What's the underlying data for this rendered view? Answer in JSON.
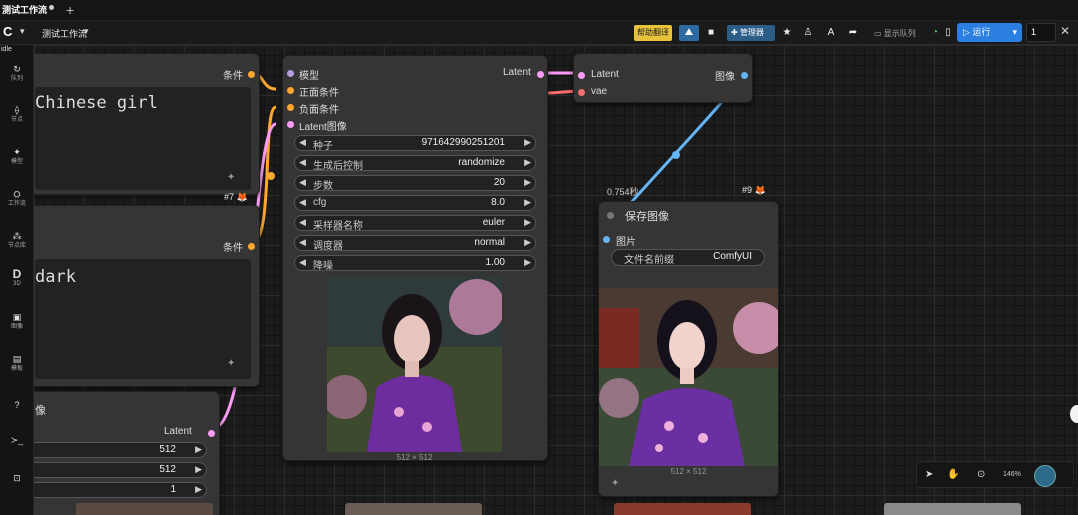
{
  "tab": {
    "title": "测试工作流",
    "add": "+"
  },
  "toolbar": {
    "logo": "C",
    "workflow_name": "测试工作流",
    "yellow_button": "帮助翻译",
    "manager_button": "管理器",
    "queue_label": "显示队列",
    "run_button": "运行",
    "run_count": "1",
    "close": "✕"
  },
  "status_label": "idle",
  "leftbar": {
    "items": [
      {
        "icon": "↻",
        "label": "队列"
      },
      {
        "icon": "⟠",
        "label": "节点"
      },
      {
        "icon": "✦",
        "label": "模型"
      },
      {
        "icon": "⛭",
        "label": "工作流"
      },
      {
        "icon": "⁂",
        "label": "节点库"
      },
      {
        "icon": "D",
        "label": "3D"
      },
      {
        "icon": "▣",
        "label": "图像"
      },
      {
        "icon": "▤",
        "label": "模板"
      },
      {
        "icon": "?",
        "label": ""
      },
      {
        "icon": "≻_",
        "label": ""
      },
      {
        "icon": "⊡",
        "label": ""
      }
    ]
  },
  "nodes": {
    "clip_pos": {
      "output": "条件",
      "text": "Chinese girl",
      "badge": "#7"
    },
    "clip_neg": {
      "output": "条件",
      "text": "dark"
    },
    "latent": {
      "title": "像",
      "output": "Latent",
      "width": "512",
      "height": "512",
      "batch": "1"
    },
    "ksampler": {
      "inputs": [
        "模型",
        "正面条件",
        "负面条件",
        "Latent图像"
      ],
      "output": "Latent",
      "widgets": [
        {
          "label": "种子",
          "value": "971642990251201"
        },
        {
          "label": "生成后控制",
          "value": "randomize"
        },
        {
          "label": "步数",
          "value": "20"
        },
        {
          "label": "cfg",
          "value": "8.0"
        },
        {
          "label": "采样器名称",
          "value": "euler"
        },
        {
          "label": "调度器",
          "value": "normal"
        },
        {
          "label": "降噪",
          "value": "1.00"
        }
      ],
      "caption": "512 × 512"
    },
    "vae_decode": {
      "inputs": [
        "Latent",
        "vae"
      ],
      "output": "图像"
    },
    "save": {
      "time": "0.754秒",
      "badge": "#9",
      "title": "保存图像",
      "input": "图片",
      "prefix_label": "文件名前缀",
      "prefix_value": "ComfyUI",
      "caption": "512 × 512"
    }
  },
  "bottombar": {
    "zoom": "146%"
  },
  "colors": {
    "accent_blue": "#2a7fe0",
    "conditioning": "#ffa931",
    "latent": "#ff9cf9",
    "image": "#64b5f6",
    "vae": "#ff6e6e",
    "model": "#b39ddb"
  }
}
